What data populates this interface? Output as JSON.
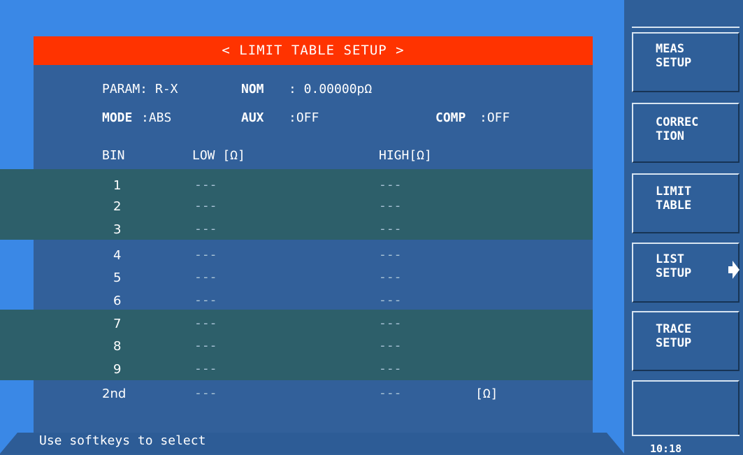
{
  "screen": {
    "title": "< LIMIT TABLE SETUP >",
    "param_label": "PARAM:",
    "param_value": "R-X",
    "nom_label": "NOM",
    "nom_value": ": 0.00000pΩ",
    "mode_label": "MODE",
    "mode_value": ":ABS",
    "aux_label": "AUX",
    "aux_value": ":OFF",
    "comp_label": "COMP",
    "comp_value": ":OFF"
  },
  "table": {
    "headers": {
      "bin": "BIN",
      "low": "LOW [Ω]",
      "high": "HIGH[Ω]"
    },
    "rows": [
      {
        "bin": "1",
        "low": "---",
        "high": "---"
      },
      {
        "bin": "2",
        "low": "---",
        "high": "---"
      },
      {
        "bin": "3",
        "low": "---",
        "high": "---"
      },
      {
        "bin": "4",
        "low": "---",
        "high": "---"
      },
      {
        "bin": "5",
        "low": "---",
        "high": "---"
      },
      {
        "bin": "6",
        "low": "---",
        "high": "---"
      },
      {
        "bin": "7",
        "low": "---",
        "high": "---"
      },
      {
        "bin": "8",
        "low": "---",
        "high": "---"
      },
      {
        "bin": "9",
        "low": "---",
        "high": "---"
      },
      {
        "bin": "2nd",
        "low": "---",
        "high": "---",
        "unit": "[Ω]"
      }
    ]
  },
  "status": {
    "text": "Use softkeys to select"
  },
  "softkeys": [
    {
      "label": "MEAS\nSETUP"
    },
    {
      "label": "CORREC\nTION"
    },
    {
      "label": "LIMIT\nTABLE"
    },
    {
      "label": "LIST\nSETUP"
    },
    {
      "label": "TRACE\nSETUP"
    },
    {
      "label": ""
    }
  ],
  "clock": "10:18",
  "colors": {
    "title_bar": "#ff3300",
    "panel": "#32609a",
    "band": "#2d5f6a",
    "background": "#3a88e6"
  }
}
